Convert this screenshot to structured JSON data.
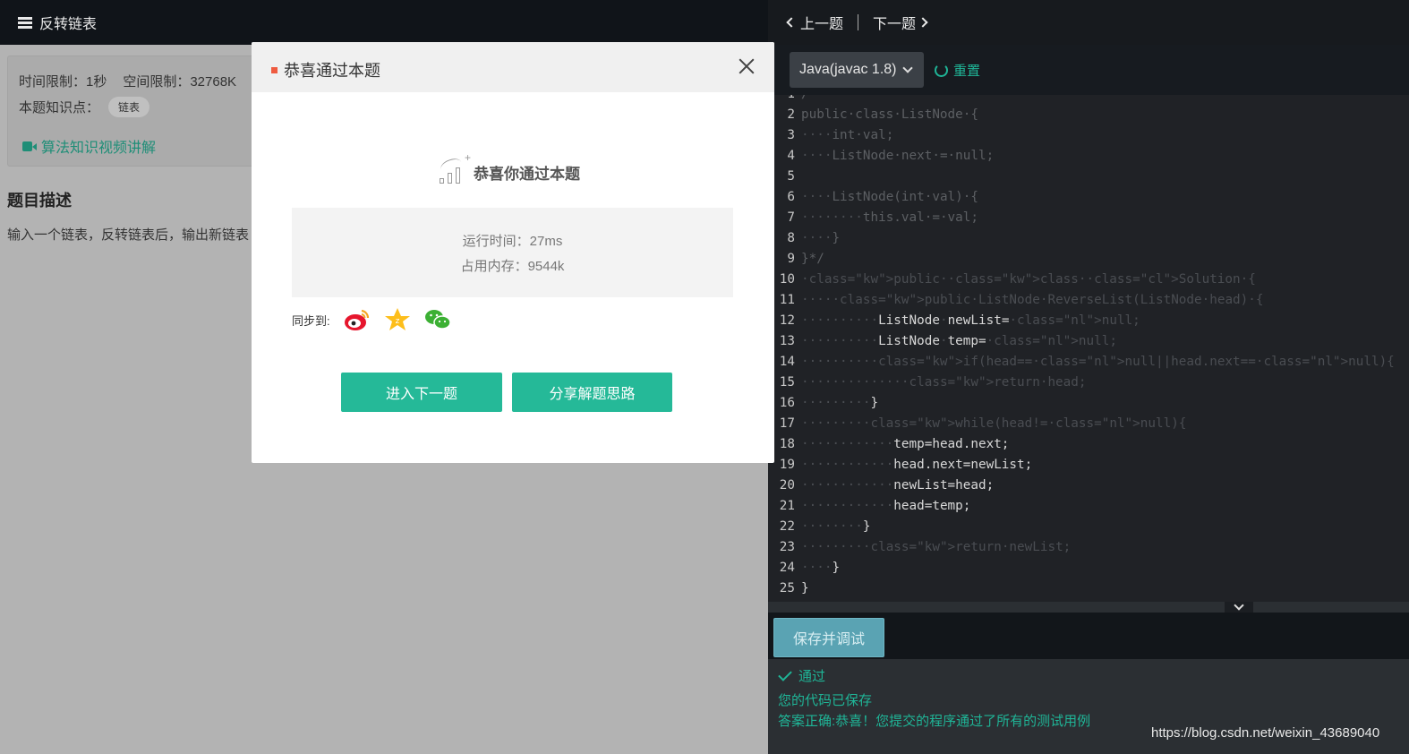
{
  "left": {
    "title": "反转链表",
    "time_limit": "时间限制：1秒",
    "space_limit": "空间限制：32768K",
    "knowledge_label": "本题知识点：",
    "knowledge_tag": "链表",
    "video_link": "算法知识视频讲解",
    "desc_title": "题目描述",
    "desc_text": "输入一个链表，反转链表后，输出新链表"
  },
  "right": {
    "prev": "上一题",
    "next": "下一题",
    "language": "Java(javac 1.8)",
    "reset": "重置",
    "save_button": "保存并调试",
    "result_status": "通过",
    "result_saved": "您的代码已保存",
    "result_message": "答案正确:恭喜！您提交的程序通过了所有的测试用例"
  },
  "code_lines": [
    {
      "n": "1",
      "text": "/"
    },
    {
      "n": "2",
      "text": "public class ListNode {"
    },
    {
      "n": "3",
      "text": "    int val;"
    },
    {
      "n": "4",
      "text": "    ListNode next = null;"
    },
    {
      "n": "5",
      "text": ""
    },
    {
      "n": "6",
      "text": "    ListNode(int val) {"
    },
    {
      "n": "7",
      "text": "        this.val = val;"
    },
    {
      "n": "8",
      "text": "    }"
    },
    {
      "n": "9",
      "text": "}*/"
    },
    {
      "n": "10",
      "text": "public class Solution {"
    },
    {
      "n": "11",
      "text": "    public ListNode ReverseList(ListNode head) {"
    },
    {
      "n": "12",
      "text": "          ListNode newList=null;"
    },
    {
      "n": "13",
      "text": "          ListNode temp=null;"
    },
    {
      "n": "14",
      "text": "         if(head==null||head.next==null){"
    },
    {
      "n": "15",
      "text": "             return head;"
    },
    {
      "n": "16",
      "text": "         }"
    },
    {
      "n": "17",
      "text": "        while(head!=null){"
    },
    {
      "n": "18",
      "text": "            temp=head.next;"
    },
    {
      "n": "19",
      "text": "            head.next=newList;"
    },
    {
      "n": "20",
      "text": "            newList=head;"
    },
    {
      "n": "21",
      "text": "            head=temp;"
    },
    {
      "n": "22",
      "text": "        }"
    },
    {
      "n": "23",
      "text": "        return newList;"
    },
    {
      "n": "24",
      "text": "    }"
    },
    {
      "n": "25",
      "text": "}"
    }
  ],
  "modal": {
    "title": "恭喜通过本题",
    "congrats": "恭喜你通过本题",
    "run_time": "运行时间：27ms",
    "memory": "占用内存：9544k",
    "sync_label": "同步到:",
    "next_button": "进入下一题",
    "share_button": "分享解题思路"
  },
  "icons": [
    "list-icon",
    "camera-icon",
    "chevron-left-icon",
    "chevron-right-icon",
    "chevron-down-icon",
    "refresh-icon",
    "check-icon",
    "close-icon",
    "chart-icon",
    "weibo-icon",
    "qzone-icon",
    "wechat-icon"
  ],
  "colors": {
    "accent": "#25b998",
    "topbar": "#101419",
    "editor_bg": "#202226",
    "keyword": "#e8344b",
    "null_literal": "#8a6be3",
    "class_name": "#f0933b"
  },
  "watermark": "https://blog.csdn.net/weixin_43689040"
}
